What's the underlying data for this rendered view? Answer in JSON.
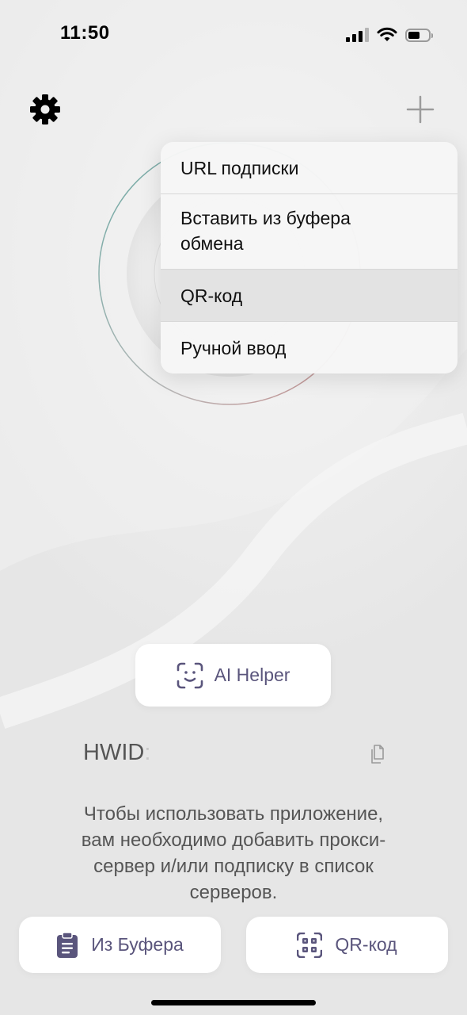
{
  "status_bar": {
    "time": "11:50",
    "icons": [
      "signal-icon",
      "wifi-icon",
      "battery-icon"
    ]
  },
  "top_bar": {
    "left_icon": "gear-icon",
    "right_icon": "plus-icon"
  },
  "menu": {
    "items": [
      {
        "label": "URL подписки"
      },
      {
        "label_line1": "Вставить из буфера",
        "label_line2": "обмена"
      },
      {
        "label": "QR-код",
        "highlighted": true
      },
      {
        "label": "Ручной ввод"
      }
    ]
  },
  "ai_helper": {
    "icon": "face-scan-icon",
    "label": "AI Helper"
  },
  "hwid": {
    "label": "HWID",
    "separator": ":",
    "copy_icon": "copy-icon"
  },
  "info": {
    "line1": "Чтобы использовать приложение,",
    "line2": "вам необходимо добавить прокси-",
    "line3": "сервер и/или подписку в список",
    "line4": "серверов."
  },
  "actions": {
    "clipboard": {
      "icon": "clipboard-icon",
      "label": "Из Буфера"
    },
    "qr": {
      "icon": "qr-scan-icon",
      "label": "QR-код"
    }
  },
  "colors": {
    "accent_text": "#5a557c",
    "background": "#efefef",
    "menu_highlight": "#e3e3e3"
  }
}
